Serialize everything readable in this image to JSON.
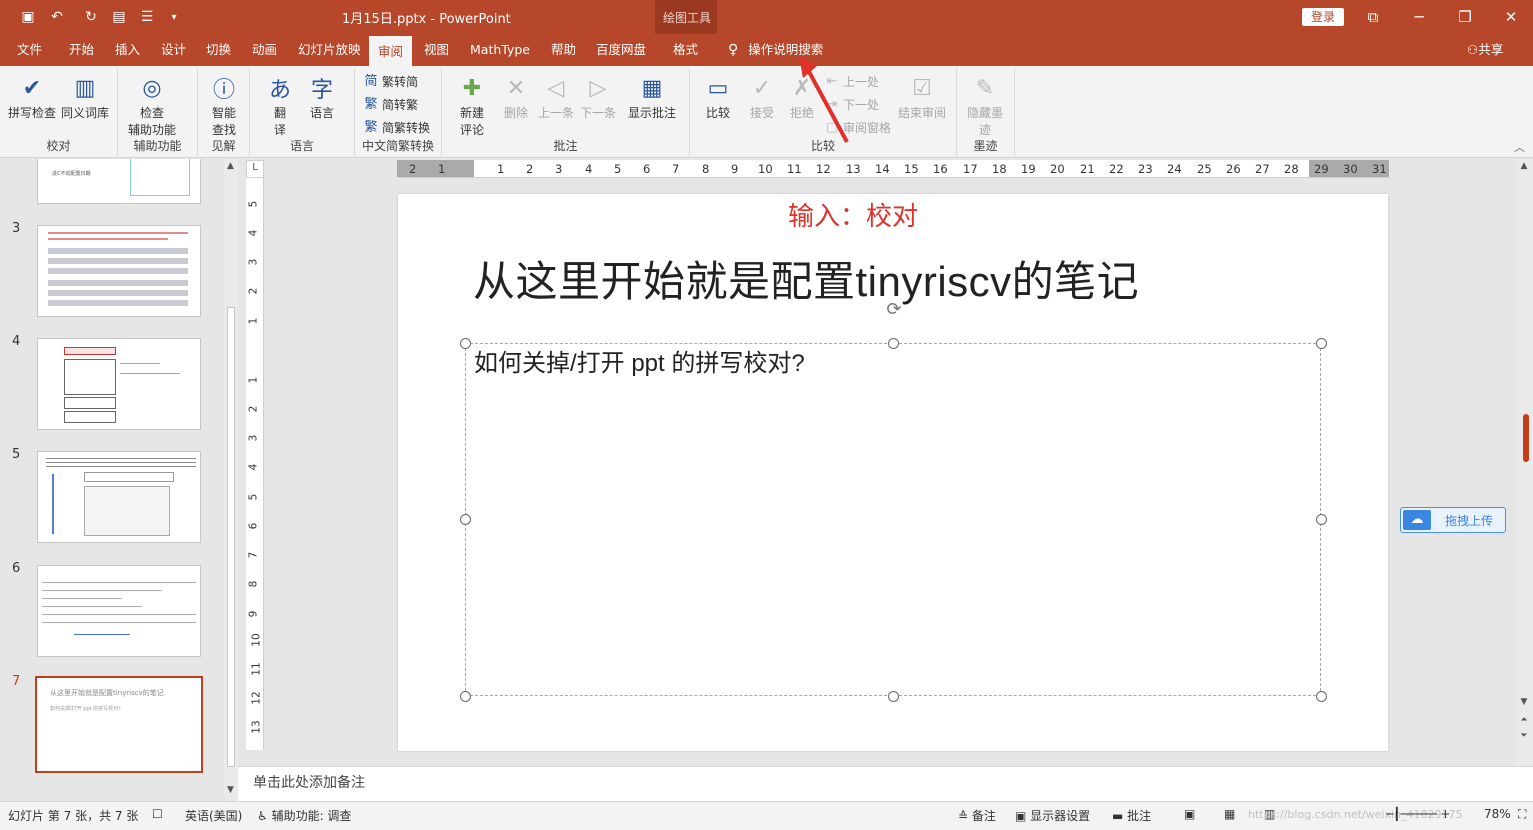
{
  "window": {
    "file_title": "1月15日.pptx - PowerPoint",
    "contextual_tab_group": "绘图工具",
    "login_label": "登录"
  },
  "menu_tabs": [
    "文件",
    "开始",
    "插入",
    "设计",
    "切换",
    "动画",
    "幻灯片放映",
    "审阅",
    "视图",
    "MathType",
    "帮助",
    "百度网盘",
    "格式"
  ],
  "active_tab": "审阅",
  "tell_me": "操作说明搜索",
  "share_label": "共享",
  "ribbon": {
    "proofing": {
      "group": "校对",
      "spell_check": "拼写检查",
      "thesaurus": "同义词库"
    },
    "accessibility": {
      "group": "辅助功能",
      "check_line1": "检查",
      "check_line2": "辅助功能"
    },
    "insights": {
      "group": "见解",
      "smart_line1": "智能",
      "smart_line2": "查找"
    },
    "language": {
      "group": "语言",
      "translate_line1": "翻",
      "translate_line2": "译",
      "language": "语言"
    },
    "chinese_conversion": {
      "group": "中文简繁转换",
      "trad_to_simp": "繁转简",
      "simp_to_trad": "简转繁",
      "conversion": "简繁转换"
    },
    "comments": {
      "group": "批注",
      "new_line1": "新建",
      "new_line2": "评论",
      "delete": "删除",
      "previous": "上一条",
      "next": "下一条",
      "show": "显示批注"
    },
    "compare": {
      "group": "比较",
      "compare": "比较",
      "accept": "接受",
      "reject": "拒绝",
      "prev_change": "上一处",
      "next_change": "下一处",
      "reviewing_pane": "审阅窗格",
      "end_review": "结束审阅"
    },
    "ink": {
      "group": "墨迹",
      "hide_line1": "隐藏墨",
      "hide_line2": "迹"
    }
  },
  "thumbnails": [
    {
      "number": "3"
    },
    {
      "number": "4"
    },
    {
      "number": "5"
    },
    {
      "number": "6"
    },
    {
      "number": "7",
      "title": "从这里开始就是配置tinyriscv的笔记",
      "subtitle": "如何关掉/打开 ppt 的拼写校对?"
    }
  ],
  "thumbnail_partial_text": "进C不动配置日期",
  "ruler": {
    "h_numbers": [
      "2",
      "1",
      "1",
      "2",
      "3",
      "4",
      "5",
      "6",
      "7",
      "8",
      "9",
      "10",
      "11",
      "12",
      "13",
      "14",
      "15",
      "16",
      "17",
      "18",
      "19",
      "20",
      "21",
      "22",
      "23",
      "24",
      "25",
      "26",
      "27",
      "28",
      "29",
      "30",
      "31"
    ],
    "v_numbers": [
      "5",
      "4",
      "3",
      "2",
      "1",
      "1",
      "2",
      "3",
      "4",
      "5",
      "6",
      "7",
      "8",
      "9",
      "10",
      "11",
      "12",
      "13"
    ],
    "corner": "L"
  },
  "slide": {
    "annotation": "输入：校对",
    "title": "从这里开始就是配置tinyriscv的笔记",
    "body": "如何关掉/打开 ppt 的拼写校对?"
  },
  "baidu_upload": "拖拽上传",
  "notes_placeholder": "单击此处添加备注",
  "status": {
    "slide_info": "幻灯片 第 7 张，共 7 张",
    "language": "英语(美国)",
    "accessibility": "辅助功能: 调查",
    "notes": "备注",
    "display_settings": "显示器设置",
    "comments": "批注",
    "zoom": "78%",
    "watermark": "https://blog.csdn.net/weixin_41829175"
  },
  "colors": {
    "accent": "#b7472a",
    "annotation_red": "#e0302a",
    "active_slide_border": "#c43e1c"
  }
}
